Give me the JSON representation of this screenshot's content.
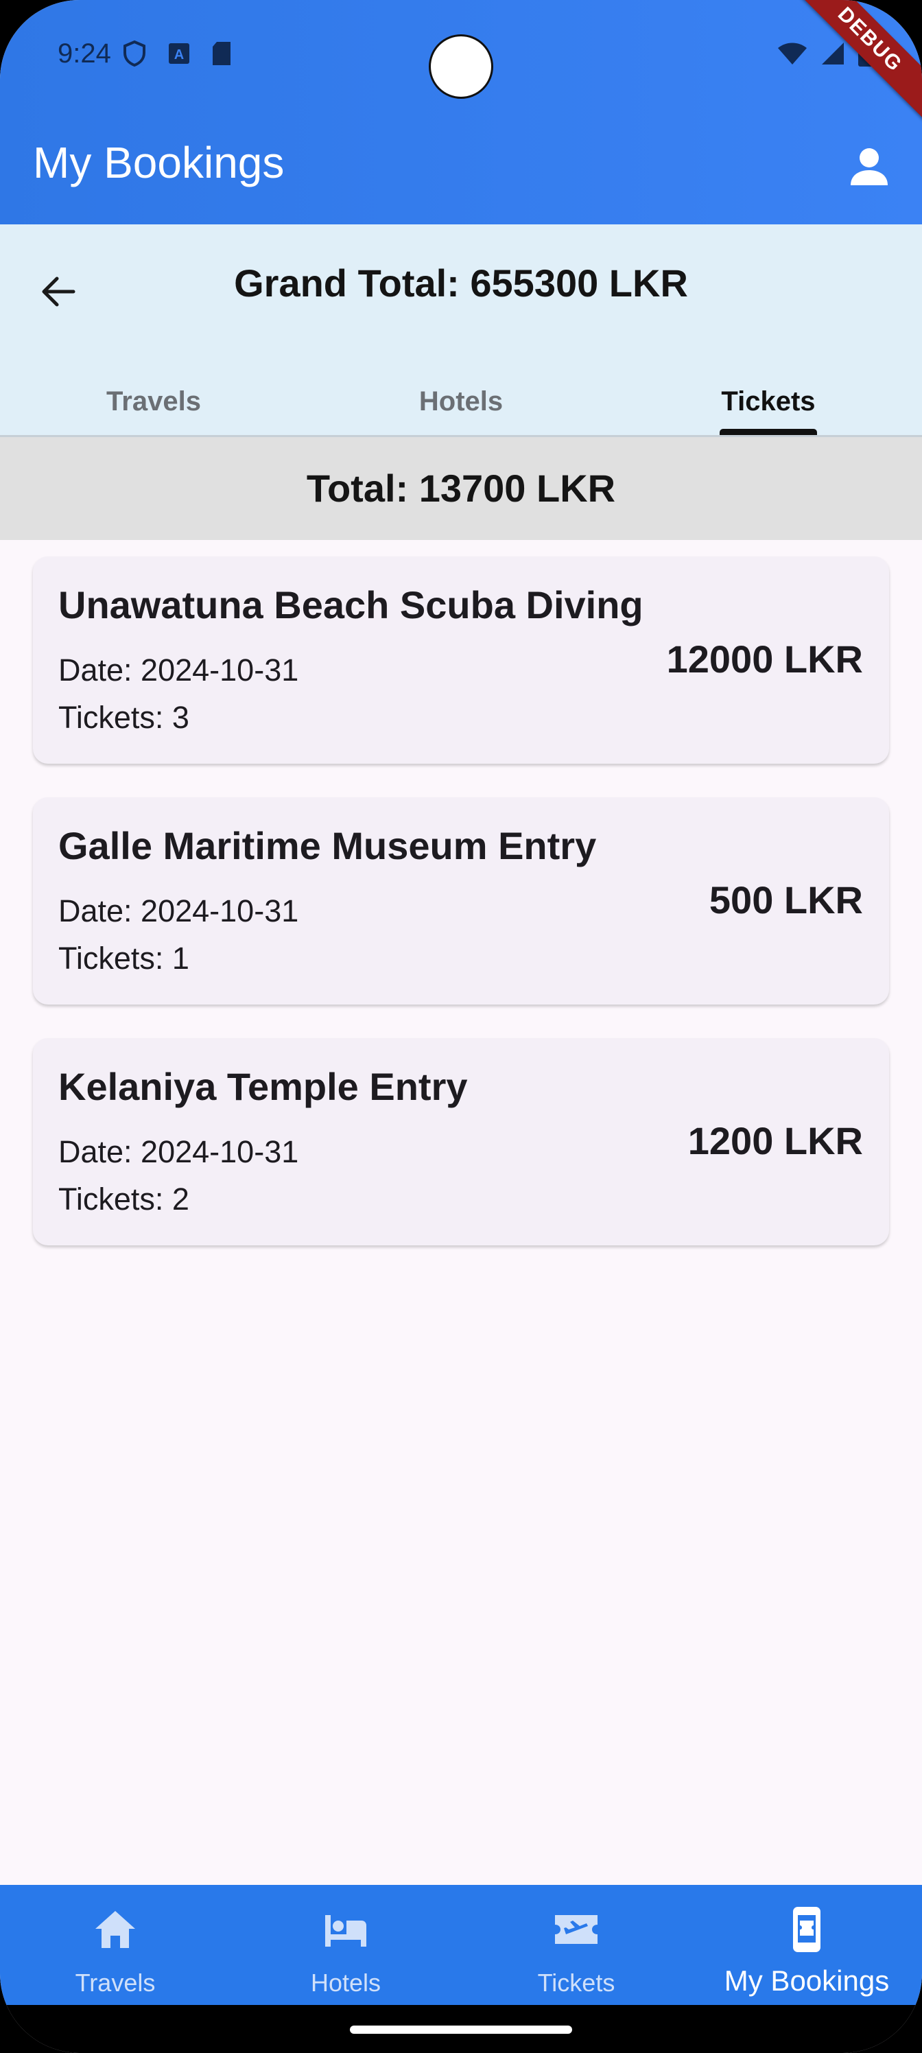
{
  "status_bar": {
    "time": "9:24"
  },
  "debug_banner": "DEBUG",
  "app_bar": {
    "title": "My Bookings"
  },
  "header": {
    "grand_total": "Grand Total: 655300 LKR",
    "tabs": [
      {
        "label": "Travels",
        "active": false
      },
      {
        "label": "Hotels",
        "active": false
      },
      {
        "label": "Tickets",
        "active": true
      }
    ]
  },
  "section_total": "Total: 13700 LKR",
  "bookings": [
    {
      "title": "Unawatuna Beach Scuba Diving",
      "date": "Date: 2024-10-31",
      "tickets": "Tickets: 3",
      "price": "12000 LKR"
    },
    {
      "title": "Galle Maritime Museum Entry",
      "date": "Date: 2024-10-31",
      "tickets": "Tickets: 1",
      "price": "500 LKR"
    },
    {
      "title": "Kelaniya Temple Entry",
      "date": "Date: 2024-10-31",
      "tickets": "Tickets: 2",
      "price": "1200 LKR"
    }
  ],
  "bottom_nav": [
    {
      "label": "Travels",
      "icon": "home-icon",
      "active": false
    },
    {
      "label": "Hotels",
      "icon": "bed-icon",
      "active": false
    },
    {
      "label": "Tickets",
      "icon": "flight-ticket-icon",
      "active": false
    },
    {
      "label": "My Bookings",
      "icon": "booking-icon",
      "active": true
    }
  ],
  "colors": {
    "app_bar": "#3b82f4",
    "header_band": "#e0eff8",
    "total_band": "#e0e0e0",
    "card": "#f4eff7",
    "bottom_nav": "#2979ea",
    "debug_ribbon": "#9b1b1b"
  }
}
